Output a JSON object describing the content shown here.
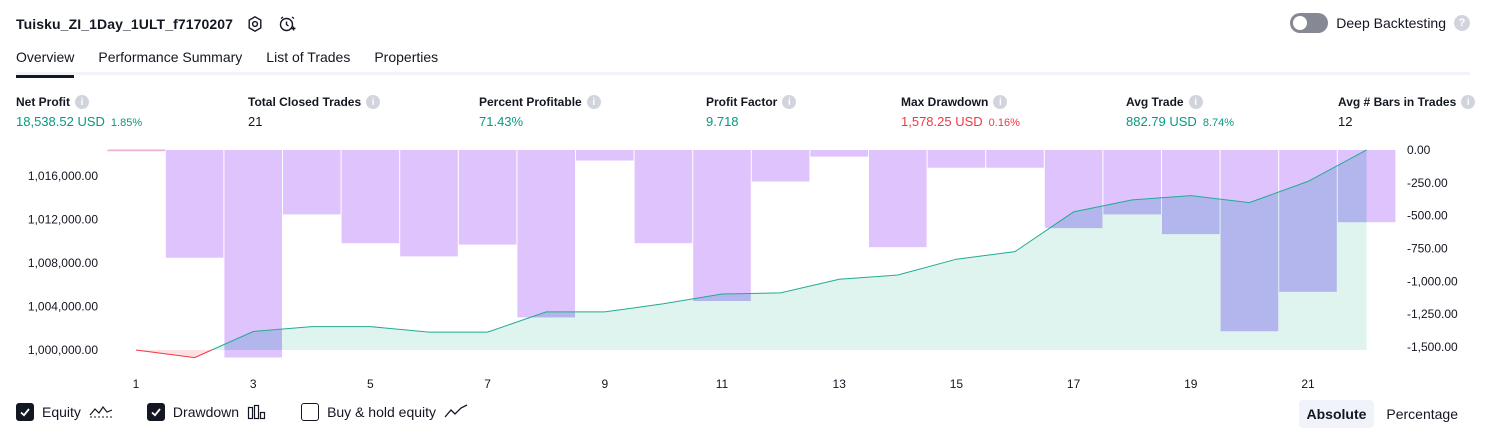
{
  "header": {
    "strategy_name": "Tuisku_ZI_1Day_1ULT_f7170207"
  },
  "deep_backtesting": {
    "label": "Deep Backtesting",
    "enabled": false,
    "help": "?"
  },
  "tabs": [
    {
      "label": "Overview",
      "active": true
    },
    {
      "label": "Performance Summary",
      "active": false
    },
    {
      "label": "List of Trades",
      "active": false
    },
    {
      "label": "Properties",
      "active": false
    }
  ],
  "stats": {
    "net_profit": {
      "label": "Net Profit",
      "value": "18,538.52 USD",
      "sub": "1.85%"
    },
    "total_closed_trades": {
      "label": "Total Closed Trades",
      "value": "21"
    },
    "percent_profitable": {
      "label": "Percent Profitable",
      "value": "71.43%"
    },
    "profit_factor": {
      "label": "Profit Factor",
      "value": "9.718"
    },
    "max_drawdown": {
      "label": "Max Drawdown",
      "value": "1,578.25 USD",
      "sub": "0.16%"
    },
    "avg_trade": {
      "label": "Avg Trade",
      "value": "882.79 USD",
      "sub": "8.74%"
    },
    "avg_bars": {
      "label": "Avg # Bars in Trades",
      "value": "12"
    },
    "info_glyph": "i"
  },
  "colors": {
    "equity_line": "#22ab94",
    "equity_fill": "#d9f2ec",
    "equity_negative": "#f23645",
    "drawdown_bar": "#dfc3fd",
    "drawdown_overlap": "#b3b6ec",
    "positive": "#089981",
    "negative": "#f23645"
  },
  "legend": {
    "equity": {
      "label": "Equity",
      "checked": true
    },
    "drawdown": {
      "label": "Drawdown",
      "checked": true
    },
    "buy_hold": {
      "label": "Buy & hold equity",
      "checked": false
    }
  },
  "mode": {
    "absolute": "Absolute",
    "percentage": "Percentage",
    "selected": "Absolute"
  },
  "chart_data": {
    "type": "area",
    "x": [
      1,
      2,
      3,
      4,
      5,
      6,
      7,
      8,
      9,
      10,
      11,
      12,
      13,
      14,
      15,
      16,
      17,
      18,
      19,
      20,
      21,
      22
    ],
    "x_tick_labels": [
      "1",
      "3",
      "5",
      "7",
      "9",
      "11",
      "13",
      "15",
      "17",
      "19",
      "21"
    ],
    "left_axis": {
      "ticks": [
        "1,000,000.00",
        "1,004,000.00",
        "1,008,000.00",
        "1,012,000.00",
        "1,016,000.00"
      ],
      "tick_values": [
        1000000,
        1004000,
        1008000,
        1012000,
        1016000
      ],
      "ylim": [
        998000,
        1018400
      ]
    },
    "right_axis": {
      "ticks": [
        "0.00",
        "-250.00",
        "-500.00",
        "-750.00",
        "-1,000.00",
        "-1,250.00",
        "-1,500.00"
      ],
      "tick_values": [
        0,
        -250,
        -500,
        -750,
        -1000,
        -1250,
        -1500
      ],
      "ylim": [
        -1650,
        0
      ]
    },
    "series": [
      {
        "name": "Equity",
        "axis": "left",
        "values": [
          1000000,
          999300,
          1001700,
          1002150,
          1002150,
          1001650,
          1001650,
          1003500,
          1003500,
          1004250,
          1005150,
          1005250,
          1006500,
          1006900,
          1008350,
          1009050,
          1012700,
          1013800,
          1014200,
          1013550,
          1015500,
          1018400
        ]
      },
      {
        "name": "Drawdown",
        "axis": "right",
        "values": [
          -10,
          -820,
          -1580,
          -490,
          -710,
          -810,
          -720,
          -1275,
          -80,
          -710,
          -1150,
          -240,
          -50,
          -740,
          -135,
          -135,
          -595,
          -490,
          -640,
          -1380,
          -1080,
          -550
        ]
      }
    ]
  }
}
